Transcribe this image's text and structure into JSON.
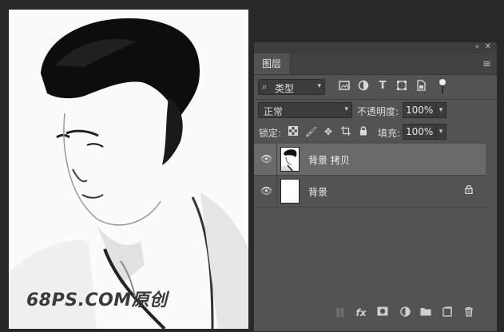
{
  "document": {
    "watermark": "68PS.COM原创"
  },
  "panel": {
    "title": "图层",
    "collapse_icon": "«",
    "close_icon": "✕",
    "menu_icon": "≡",
    "filter": {
      "kind_label": "类型"
    },
    "blend_mode": "正常",
    "opacity_label": "不透明度:",
    "opacity_value": "100%",
    "lock_label": "锁定:",
    "fill_label": "填充:",
    "fill_value": "100%",
    "layers": [
      {
        "name": "背景 拷贝",
        "visible": true,
        "selected": true,
        "locked": false
      },
      {
        "name": "背景",
        "visible": true,
        "selected": false,
        "locked": true
      }
    ],
    "footer_icons": [
      "link-icon",
      "fx-icon",
      "mask-icon",
      "adjustment-icon",
      "folder-icon",
      "new-layer-icon",
      "trash-icon"
    ]
  }
}
